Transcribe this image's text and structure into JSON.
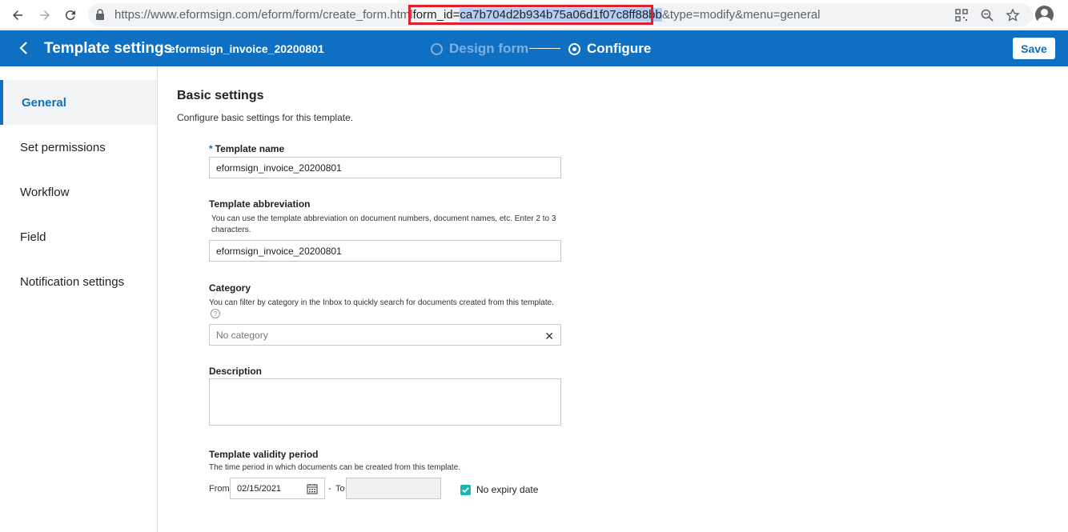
{
  "browser": {
    "url_prefix": "https://www.eformsign.com/eform/form/create_form.html",
    "url_param_key": "form_id=",
    "url_param_value": "ca7b704d2b934b75a06d1f07c8ff88bb",
    "url_suffix": "&type=modify&menu=general"
  },
  "header": {
    "title": "Template settings",
    "template_name": "eformsign_invoice_20200801",
    "steps": [
      "Design form",
      "Configure"
    ],
    "save_label": "Save"
  },
  "sidebar": {
    "items": [
      {
        "label": "General"
      },
      {
        "label": "Set permissions"
      },
      {
        "label": "Workflow"
      },
      {
        "label": "Field"
      },
      {
        "label": "Notification settings"
      }
    ]
  },
  "main": {
    "section_title": "Basic settings",
    "section_desc": "Configure basic settings for this template.",
    "template_name": {
      "required_mark": "*",
      "label": "Template name",
      "value": "eformsign_invoice_20200801"
    },
    "abbreviation": {
      "label": "Template abbreviation",
      "hint": "You can use the template abbreviation on document numbers, document names, etc. Enter 2 to 3 characters.",
      "value": "eformsign_invoice_20200801"
    },
    "category": {
      "label": "Category",
      "hint": "You can filter by category in the Inbox to quickly search for documents created from this template.",
      "help_glyph": "?",
      "value": "No category",
      "clear_glyph": "✕"
    },
    "description": {
      "label": "Description",
      "value": ""
    },
    "validity": {
      "label": "Template validity period",
      "hint": "The time period in which documents can be created from this template.",
      "from_label": "From",
      "from_value": "02/15/2021",
      "separator": "-",
      "to_label": "To",
      "to_value": "",
      "no_expiry_label": "No expiry date",
      "no_expiry_checked": true
    }
  },
  "colors": {
    "brand": "#0f6fc2",
    "checkbox": "#1ab5b0",
    "highlight": "#e0202a"
  }
}
